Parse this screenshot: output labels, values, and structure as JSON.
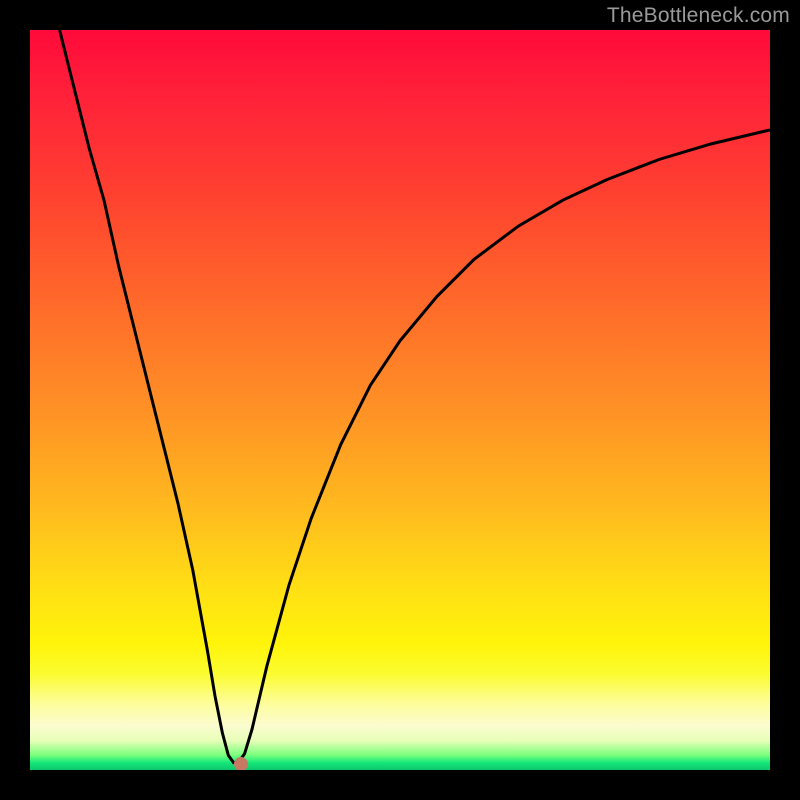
{
  "watermark": "TheBottleneck.com",
  "chart_data": {
    "type": "line",
    "title": "",
    "xlabel": "",
    "ylabel": "",
    "xlim": [
      0,
      100
    ],
    "ylim": [
      0,
      100
    ],
    "series": [
      {
        "name": "curve",
        "x": [
          4,
          6,
          8,
          10,
          12,
          14,
          16,
          18,
          20,
          22,
          24,
          25,
          26,
          26.8,
          27.5,
          28.2,
          29,
          30,
          32,
          35,
          38,
          42,
          46,
          50,
          55,
          60,
          66,
          72,
          78,
          85,
          92,
          100
        ],
        "y": [
          100,
          92,
          84,
          77,
          68,
          60,
          52,
          44,
          36,
          27,
          16,
          10,
          5,
          2,
          1,
          1.1,
          2.2,
          5.5,
          14,
          25,
          34,
          44,
          52,
          58,
          64,
          69,
          73.5,
          77,
          79.8,
          82.5,
          84.6,
          86.5
        ]
      }
    ],
    "marker": {
      "x": 28.5,
      "y": 0.8
    },
    "gradient_stops": [
      {
        "pos": 0,
        "color": "#ff0a3a"
      },
      {
        "pos": 22,
        "color": "#ff4030"
      },
      {
        "pos": 52,
        "color": "#ff9325"
      },
      {
        "pos": 76,
        "color": "#ffe114"
      },
      {
        "pos": 91,
        "color": "#fdfd9a"
      },
      {
        "pos": 98,
        "color": "#79ff7c"
      },
      {
        "pos": 100,
        "color": "#0cc66c"
      }
    ]
  }
}
